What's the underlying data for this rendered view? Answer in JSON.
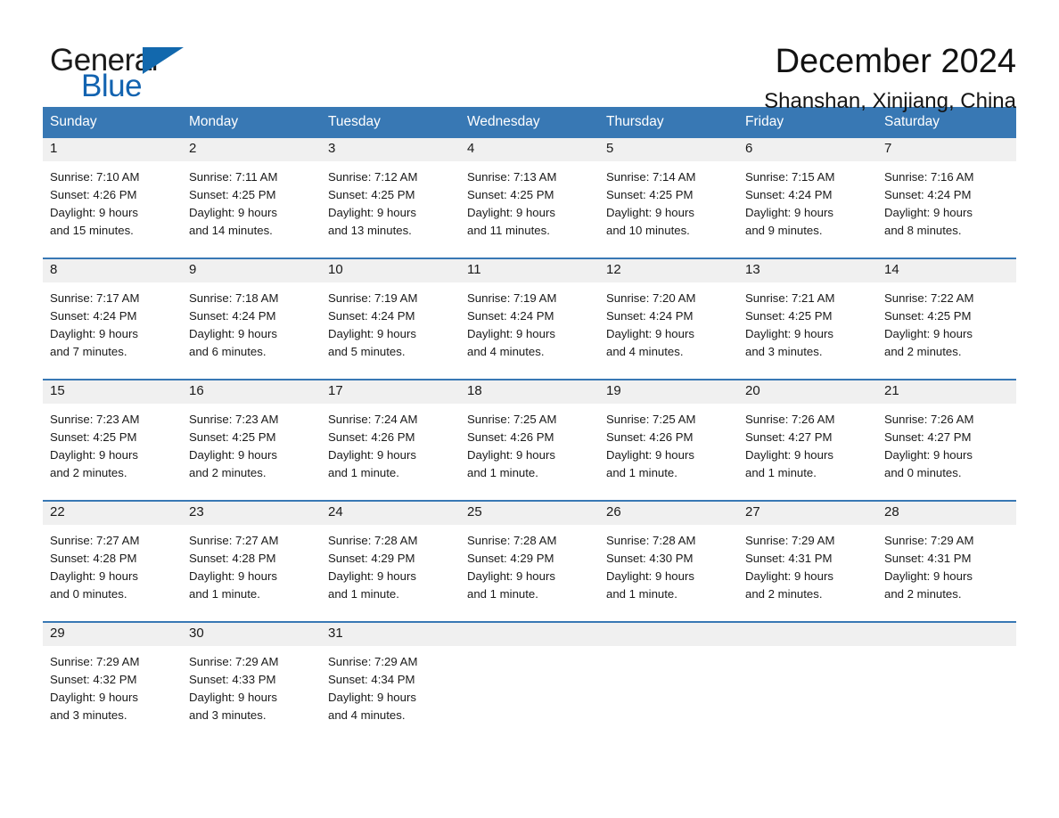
{
  "brand": {
    "name_part1": "General",
    "name_part2": "Blue",
    "triangle_color": "#1268ad",
    "blue_color": "#1263b0"
  },
  "header": {
    "month_title": "December 2024",
    "location": "Shanshan, Xinjiang, China"
  },
  "theme": {
    "header_bg": "#3878b4",
    "header_text": "#ffffff",
    "daynum_band_bg": "#f0f0f0",
    "row_divider": "#3878b4",
    "body_text": "#1a1a1a"
  },
  "weekdays": [
    "Sunday",
    "Monday",
    "Tuesday",
    "Wednesday",
    "Thursday",
    "Friday",
    "Saturday"
  ],
  "weeks": [
    [
      {
        "day": "1",
        "l1": "Sunrise: 7:10 AM",
        "l2": "Sunset: 4:26 PM",
        "l3": "Daylight: 9 hours",
        "l4": "and 15 minutes."
      },
      {
        "day": "2",
        "l1": "Sunrise: 7:11 AM",
        "l2": "Sunset: 4:25 PM",
        "l3": "Daylight: 9 hours",
        "l4": "and 14 minutes."
      },
      {
        "day": "3",
        "l1": "Sunrise: 7:12 AM",
        "l2": "Sunset: 4:25 PM",
        "l3": "Daylight: 9 hours",
        "l4": "and 13 minutes."
      },
      {
        "day": "4",
        "l1": "Sunrise: 7:13 AM",
        "l2": "Sunset: 4:25 PM",
        "l3": "Daylight: 9 hours",
        "l4": "and 11 minutes."
      },
      {
        "day": "5",
        "l1": "Sunrise: 7:14 AM",
        "l2": "Sunset: 4:25 PM",
        "l3": "Daylight: 9 hours",
        "l4": "and 10 minutes."
      },
      {
        "day": "6",
        "l1": "Sunrise: 7:15 AM",
        "l2": "Sunset: 4:24 PM",
        "l3": "Daylight: 9 hours",
        "l4": "and 9 minutes."
      },
      {
        "day": "7",
        "l1": "Sunrise: 7:16 AM",
        "l2": "Sunset: 4:24 PM",
        "l3": "Daylight: 9 hours",
        "l4": "and 8 minutes."
      }
    ],
    [
      {
        "day": "8",
        "l1": "Sunrise: 7:17 AM",
        "l2": "Sunset: 4:24 PM",
        "l3": "Daylight: 9 hours",
        "l4": "and 7 minutes."
      },
      {
        "day": "9",
        "l1": "Sunrise: 7:18 AM",
        "l2": "Sunset: 4:24 PM",
        "l3": "Daylight: 9 hours",
        "l4": "and 6 minutes."
      },
      {
        "day": "10",
        "l1": "Sunrise: 7:19 AM",
        "l2": "Sunset: 4:24 PM",
        "l3": "Daylight: 9 hours",
        "l4": "and 5 minutes."
      },
      {
        "day": "11",
        "l1": "Sunrise: 7:19 AM",
        "l2": "Sunset: 4:24 PM",
        "l3": "Daylight: 9 hours",
        "l4": "and 4 minutes."
      },
      {
        "day": "12",
        "l1": "Sunrise: 7:20 AM",
        "l2": "Sunset: 4:24 PM",
        "l3": "Daylight: 9 hours",
        "l4": "and 4 minutes."
      },
      {
        "day": "13",
        "l1": "Sunrise: 7:21 AM",
        "l2": "Sunset: 4:25 PM",
        "l3": "Daylight: 9 hours",
        "l4": "and 3 minutes."
      },
      {
        "day": "14",
        "l1": "Sunrise: 7:22 AM",
        "l2": "Sunset: 4:25 PM",
        "l3": "Daylight: 9 hours",
        "l4": "and 2 minutes."
      }
    ],
    [
      {
        "day": "15",
        "l1": "Sunrise: 7:23 AM",
        "l2": "Sunset: 4:25 PM",
        "l3": "Daylight: 9 hours",
        "l4": "and 2 minutes."
      },
      {
        "day": "16",
        "l1": "Sunrise: 7:23 AM",
        "l2": "Sunset: 4:25 PM",
        "l3": "Daylight: 9 hours",
        "l4": "and 2 minutes."
      },
      {
        "day": "17",
        "l1": "Sunrise: 7:24 AM",
        "l2": "Sunset: 4:26 PM",
        "l3": "Daylight: 9 hours",
        "l4": "and 1 minute."
      },
      {
        "day": "18",
        "l1": "Sunrise: 7:25 AM",
        "l2": "Sunset: 4:26 PM",
        "l3": "Daylight: 9 hours",
        "l4": "and 1 minute."
      },
      {
        "day": "19",
        "l1": "Sunrise: 7:25 AM",
        "l2": "Sunset: 4:26 PM",
        "l3": "Daylight: 9 hours",
        "l4": "and 1 minute."
      },
      {
        "day": "20",
        "l1": "Sunrise: 7:26 AM",
        "l2": "Sunset: 4:27 PM",
        "l3": "Daylight: 9 hours",
        "l4": "and 1 minute."
      },
      {
        "day": "21",
        "l1": "Sunrise: 7:26 AM",
        "l2": "Sunset: 4:27 PM",
        "l3": "Daylight: 9 hours",
        "l4": "and 0 minutes."
      }
    ],
    [
      {
        "day": "22",
        "l1": "Sunrise: 7:27 AM",
        "l2": "Sunset: 4:28 PM",
        "l3": "Daylight: 9 hours",
        "l4": "and 0 minutes."
      },
      {
        "day": "23",
        "l1": "Sunrise: 7:27 AM",
        "l2": "Sunset: 4:28 PM",
        "l3": "Daylight: 9 hours",
        "l4": "and 1 minute."
      },
      {
        "day": "24",
        "l1": "Sunrise: 7:28 AM",
        "l2": "Sunset: 4:29 PM",
        "l3": "Daylight: 9 hours",
        "l4": "and 1 minute."
      },
      {
        "day": "25",
        "l1": "Sunrise: 7:28 AM",
        "l2": "Sunset: 4:29 PM",
        "l3": "Daylight: 9 hours",
        "l4": "and 1 minute."
      },
      {
        "day": "26",
        "l1": "Sunrise: 7:28 AM",
        "l2": "Sunset: 4:30 PM",
        "l3": "Daylight: 9 hours",
        "l4": "and 1 minute."
      },
      {
        "day": "27",
        "l1": "Sunrise: 7:29 AM",
        "l2": "Sunset: 4:31 PM",
        "l3": "Daylight: 9 hours",
        "l4": "and 2 minutes."
      },
      {
        "day": "28",
        "l1": "Sunrise: 7:29 AM",
        "l2": "Sunset: 4:31 PM",
        "l3": "Daylight: 9 hours",
        "l4": "and 2 minutes."
      }
    ],
    [
      {
        "day": "29",
        "l1": "Sunrise: 7:29 AM",
        "l2": "Sunset: 4:32 PM",
        "l3": "Daylight: 9 hours",
        "l4": "and 3 minutes."
      },
      {
        "day": "30",
        "l1": "Sunrise: 7:29 AM",
        "l2": "Sunset: 4:33 PM",
        "l3": "Daylight: 9 hours",
        "l4": "and 3 minutes."
      },
      {
        "day": "31",
        "l1": "Sunrise: 7:29 AM",
        "l2": "Sunset: 4:34 PM",
        "l3": "Daylight: 9 hours",
        "l4": "and 4 minutes."
      },
      {
        "day": "",
        "l1": "",
        "l2": "",
        "l3": "",
        "l4": ""
      },
      {
        "day": "",
        "l1": "",
        "l2": "",
        "l3": "",
        "l4": ""
      },
      {
        "day": "",
        "l1": "",
        "l2": "",
        "l3": "",
        "l4": ""
      },
      {
        "day": "",
        "l1": "",
        "l2": "",
        "l3": "",
        "l4": ""
      }
    ]
  ]
}
